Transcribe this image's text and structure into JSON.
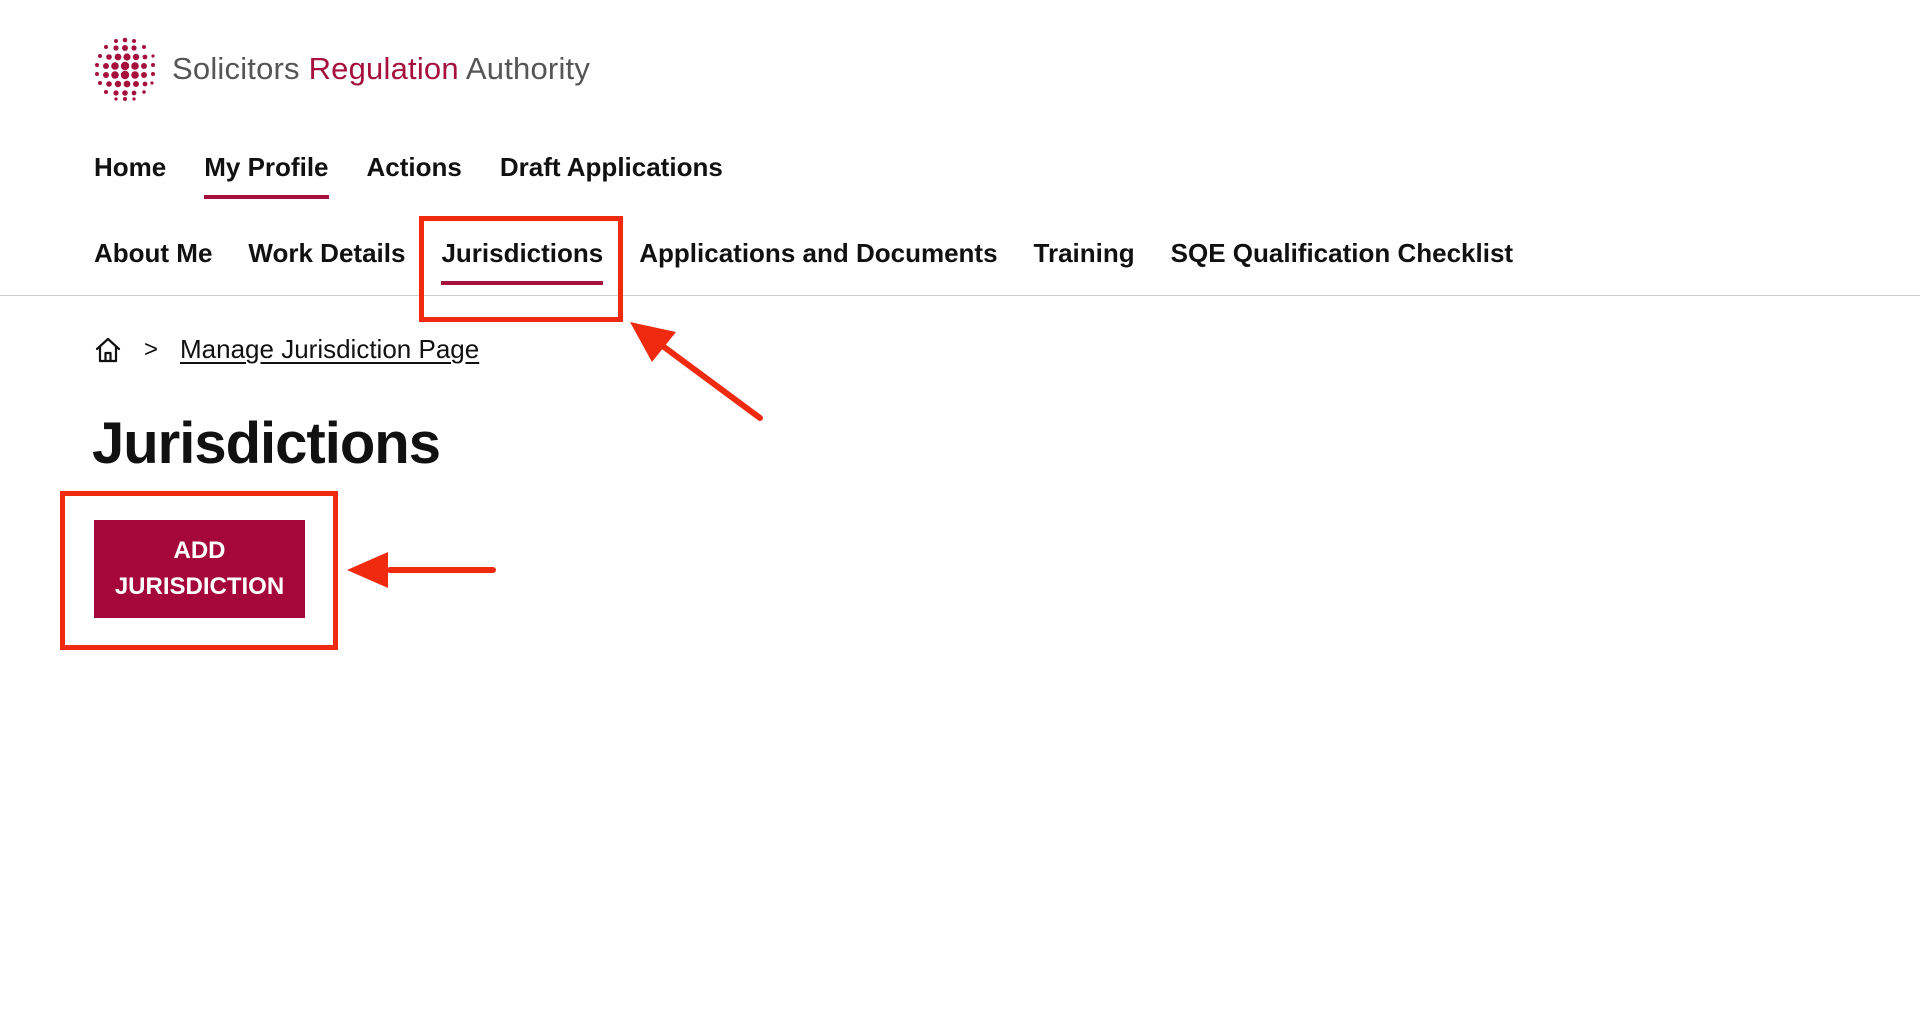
{
  "brand": {
    "name_part1": "Solicitors",
    "name_part2": "Regulation",
    "name_part3": "Authority",
    "accent_color": "#a5113c",
    "logo_icon": "dotted-sphere-icon"
  },
  "primary_nav": {
    "items": [
      {
        "label": "Home",
        "active": false
      },
      {
        "label": "My Profile",
        "active": true
      },
      {
        "label": "Actions",
        "active": false
      },
      {
        "label": "Draft Applications",
        "active": false
      }
    ]
  },
  "secondary_nav": {
    "items": [
      {
        "label": "About Me",
        "active": false
      },
      {
        "label": "Work Details",
        "active": false
      },
      {
        "label": "Jurisdictions",
        "active": true
      },
      {
        "label": "Applications and Documents",
        "active": false
      },
      {
        "label": "Training",
        "active": false
      },
      {
        "label": "SQE Qualification Checklist",
        "active": false
      }
    ]
  },
  "breadcrumb": {
    "home_icon": "home-icon",
    "separator": ">",
    "current": "Manage Jurisdiction Page"
  },
  "page": {
    "title": "Jurisdictions",
    "add_button_line1": "ADD",
    "add_button_line2": "JURISDICTION",
    "button_color": "#a5073b"
  },
  "annotations": {
    "highlight_color": "#ef2a0f"
  }
}
